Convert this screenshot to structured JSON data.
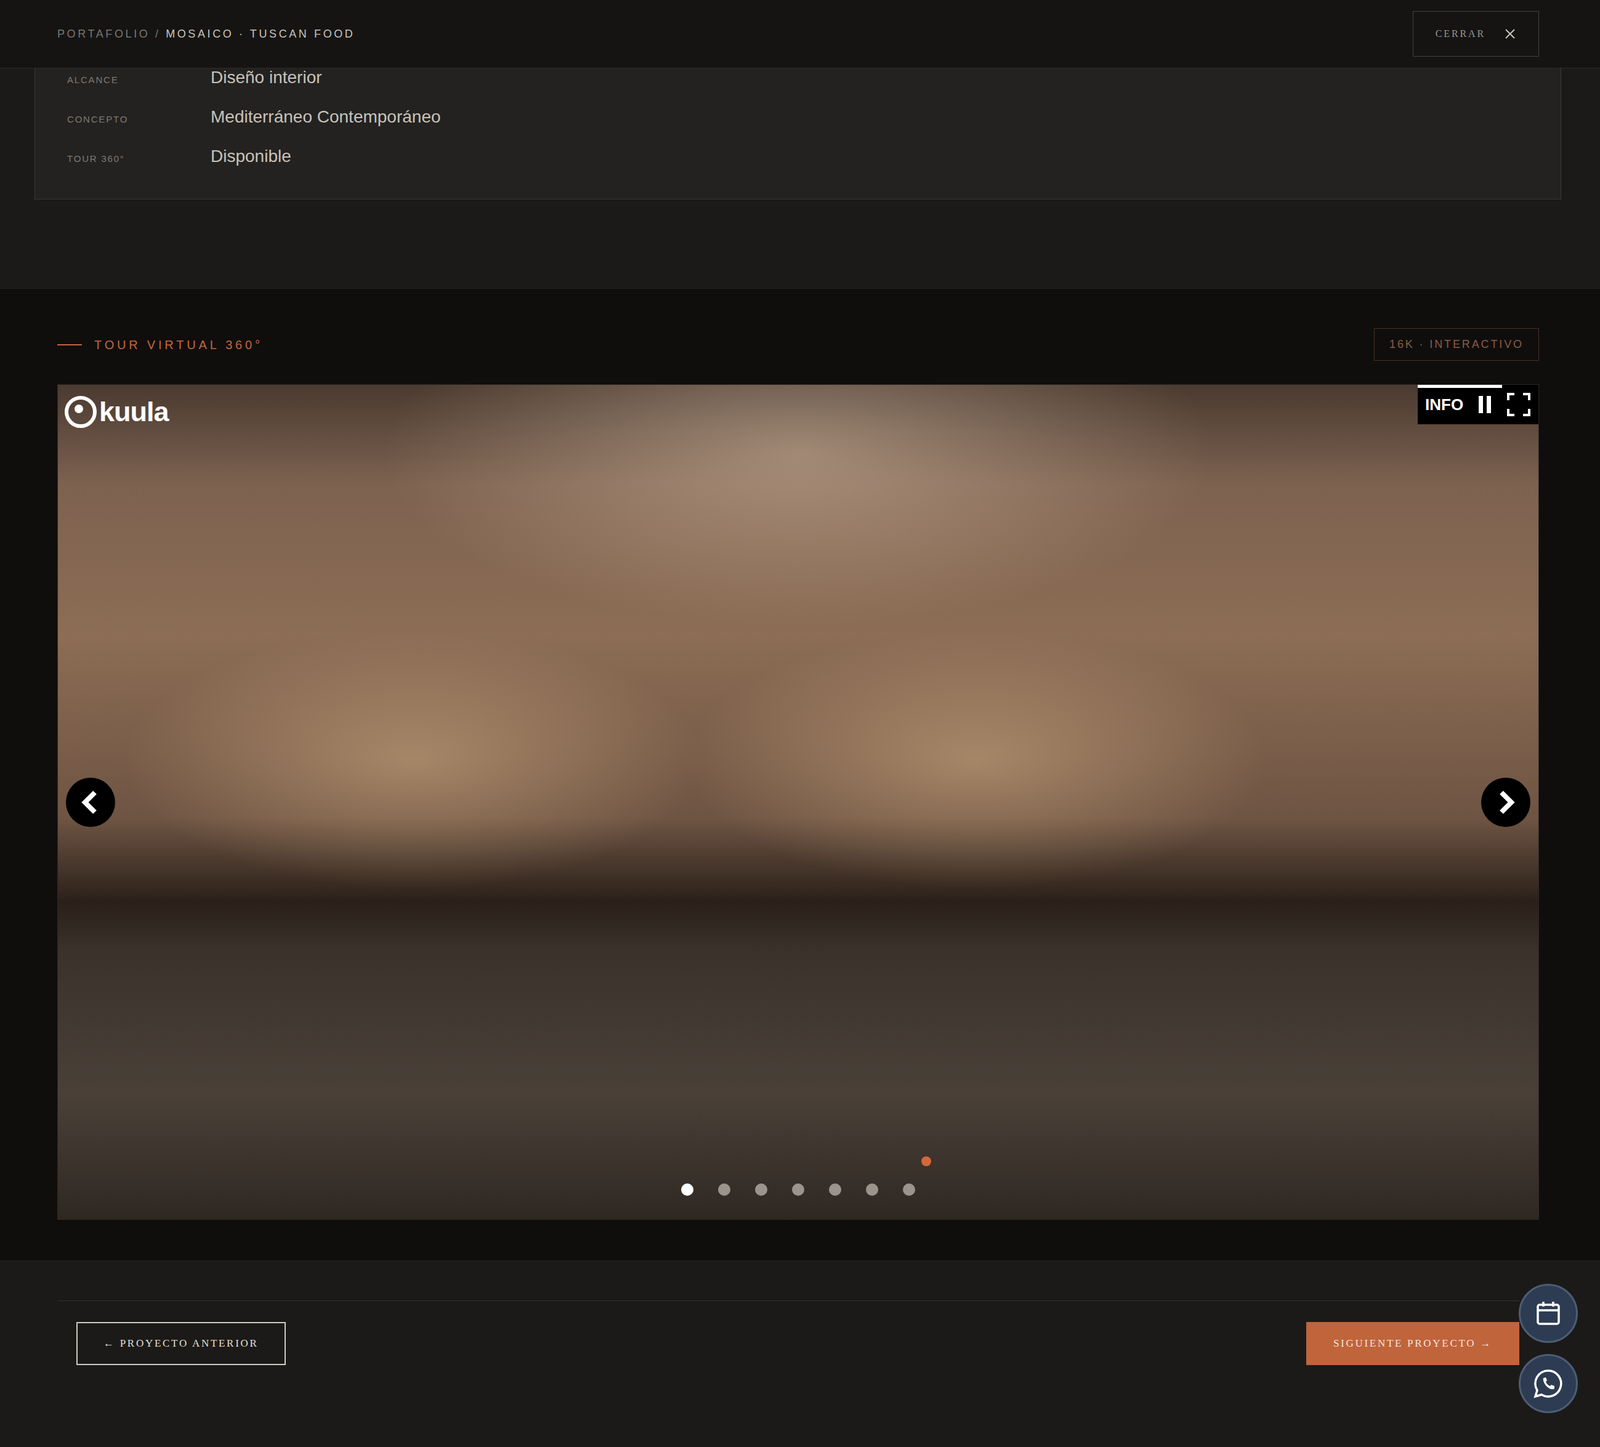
{
  "breadcrumb": {
    "parent": "PORTAFOLIO /",
    "current": "MOSAICO · TUSCAN FOOD"
  },
  "close_button": {
    "label": "CERRAR"
  },
  "details": [
    {
      "label": "ALCANCE",
      "value": "Diseño interior"
    },
    {
      "label": "CONCEPTO",
      "value": "Mediterráneo Contemporáneo"
    },
    {
      "label": "TOUR 360°",
      "value": "Disponible"
    }
  ],
  "tour": {
    "title": "TOUR VIRTUAL 360°",
    "badge": "16K · INTERACTIVO",
    "viewer": {
      "logo": "kuula",
      "info": "INFO",
      "autoplay": {
        "playing": true,
        "level": 0.7
      },
      "scenes": [
        {
          "selected": true
        },
        {
          "selected": false
        },
        {
          "selected": false
        },
        {
          "selected": false
        },
        {
          "selected": false
        },
        {
          "selected": false
        },
        {
          "selected": false
        }
      ]
    }
  },
  "nav": {
    "previous": "← PROYECTO ANTERIOR",
    "next": "SIGUIENTE PROYECTO →"
  }
}
